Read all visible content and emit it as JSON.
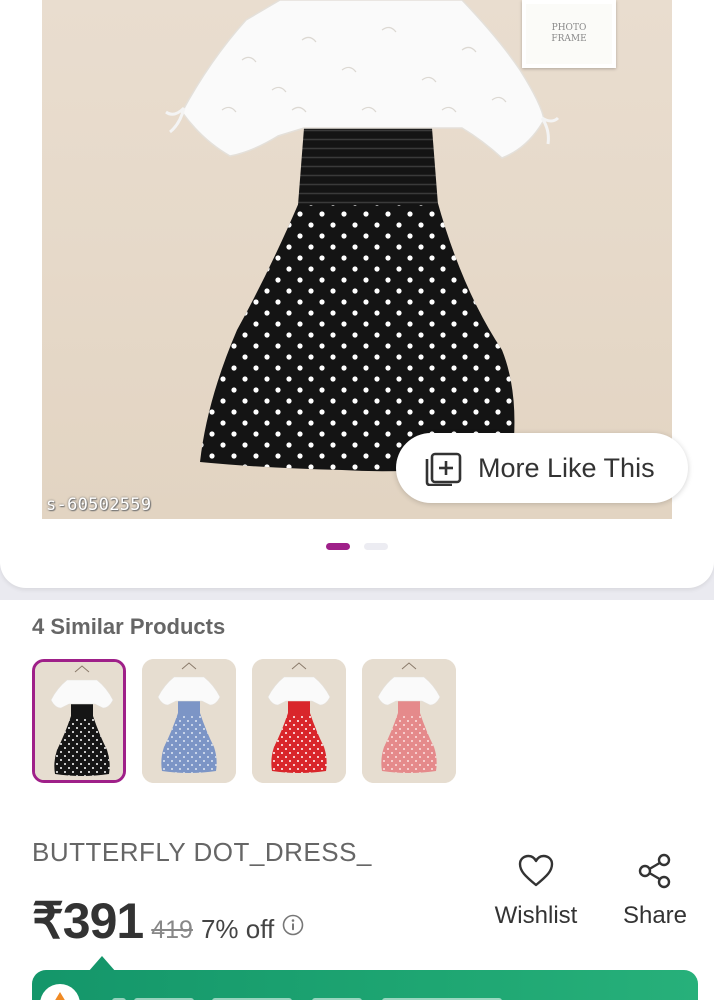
{
  "gallery": {
    "product_code": "s-60502559",
    "frame_text_line1": "PHOTO",
    "frame_text_line2": "FRAME",
    "more_like_label": "More Like This",
    "page_dots": 2,
    "active_dot": 1
  },
  "similar": {
    "title": "4 Similar Products",
    "items": [
      {
        "skirt_color": "#151515",
        "dot_color": "#ffffff",
        "selected": true
      },
      {
        "skirt_color": "#7c95c6",
        "dot_color": "#dfe6f4",
        "selected": false
      },
      {
        "skirt_color": "#d9262b",
        "dot_color": "#ffffff",
        "selected": false
      },
      {
        "skirt_color": "#e58a8b",
        "dot_color": "#fbe2e2",
        "selected": false
      }
    ]
  },
  "product": {
    "title": "BUTTERFLY DOT_DRESS_",
    "price": "₹391",
    "mrp": "419",
    "discount": "7% off"
  },
  "actions": {
    "wishlist_label": "Wishlist",
    "share_label": "Share"
  },
  "colors": {
    "accent": "#9f2089",
    "banner_green": "#1ea672"
  }
}
